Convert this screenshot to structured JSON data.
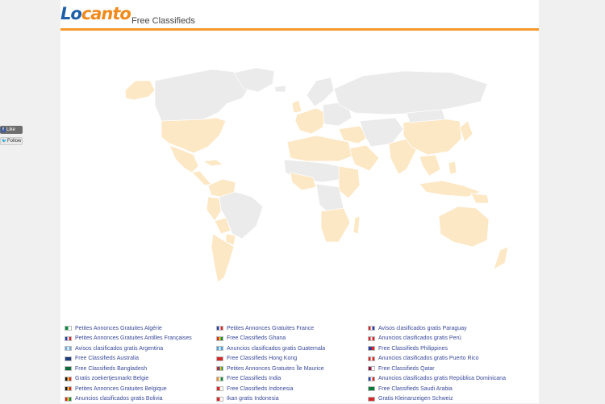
{
  "header": {
    "logo_lo": "Lo",
    "logo_canto": "canto",
    "tagline": "Free Classifieds"
  },
  "social": {
    "like_label": "Like",
    "follow_label": "Follow"
  },
  "colors": {
    "accent": "#f59a2c",
    "land_active": "#fde8c6",
    "land_inactive": "#ebebeb",
    "link": "#3a4a9a"
  },
  "countries": {
    "columns": [
      [
        {
          "label": "Petites Annonces Gratuites Algérie",
          "flag": [
            "#0a8a3c",
            "#ffffff"
          ]
        },
        {
          "label": "Petites Annonces Gratuites Antilles Françaises",
          "flag": [
            "#1f3fa6",
            "#ffffff",
            "#d62828"
          ]
        },
        {
          "label": "Avisos clasificados gratis Argentina",
          "flag": [
            "#74acdf",
            "#ffffff",
            "#74acdf"
          ]
        },
        {
          "label": "Free Classifieds Australia",
          "flag": [
            "#1f3a7a",
            "#1f3a7a"
          ]
        },
        {
          "label": "Free Classifieds Bangladesh",
          "flag": [
            "#0a6a3a",
            "#0a6a3a"
          ]
        },
        {
          "label": "Gratis zoekertjesmarkt Belgie",
          "flag": [
            "#111111",
            "#f8d52a",
            "#d62828"
          ]
        },
        {
          "label": "Petites Annonces Gratuites Belgique",
          "flag": [
            "#111111",
            "#f8d52a",
            "#d62828"
          ]
        },
        {
          "label": "Anuncios clasificados gratis Bolivia",
          "flag": [
            "#d62828",
            "#f8d52a",
            "#0a8a3c"
          ]
        }
      ],
      [
        {
          "label": "Petites Annonces Gratuites France",
          "flag": [
            "#1f3fa6",
            "#ffffff",
            "#d62828"
          ]
        },
        {
          "label": "Free Classifieds Ghana",
          "flag": [
            "#d62828",
            "#f8d52a",
            "#0a8a3c"
          ]
        },
        {
          "label": "Anuncios clasificados gratis Guatemala",
          "flag": [
            "#4aa3df",
            "#ffffff",
            "#4aa3df"
          ]
        },
        {
          "label": "Free Classifieds Hong Kong",
          "flag": [
            "#d62828",
            "#d62828"
          ]
        },
        {
          "label": "Petites Annonces Gratuites Île Maurice",
          "flag": [
            "#d62828",
            "#1f3fa6",
            "#f8d52a",
            "#0a8a3c"
          ]
        },
        {
          "label": "Free Classifieds India",
          "flag": [
            "#f48c24",
            "#ffffff",
            "#0a8a3c"
          ]
        },
        {
          "label": "Free Classifieds Indonesia",
          "flag": [
            "#d62828",
            "#ffffff"
          ]
        },
        {
          "label": "Ikan gratis Indonesia",
          "flag": [
            "#d62828",
            "#ffffff"
          ]
        }
      ],
      [
        {
          "label": "Avisos clasificados gratis Paraguay",
          "flag": [
            "#d62828",
            "#ffffff",
            "#1f3fa6"
          ]
        },
        {
          "label": "Anuncios clasificados gratis Perú",
          "flag": [
            "#d62828",
            "#ffffff",
            "#d62828"
          ]
        },
        {
          "label": "Free Classifieds Philippines",
          "flag": [
            "#1f3fa6",
            "#d62828"
          ]
        },
        {
          "label": "Anuncios clasificados gratis Puerto Rico",
          "flag": [
            "#d62828",
            "#ffffff",
            "#d62828"
          ]
        },
        {
          "label": "Free Classifieds Qatar",
          "flag": [
            "#8a1538",
            "#ffffff"
          ]
        },
        {
          "label": "Anuncios clasificados gratis República Dominicana",
          "flag": [
            "#1f3fa6",
            "#ffffff",
            "#d62828"
          ]
        },
        {
          "label": "Free Classifieds Saudi Arabia",
          "flag": [
            "#0a7a3c",
            "#0a7a3c"
          ]
        },
        {
          "label": "Gratis Kleinanzeigen Schweiz",
          "flag": [
            "#d62828",
            "#d62828"
          ]
        }
      ]
    ]
  }
}
